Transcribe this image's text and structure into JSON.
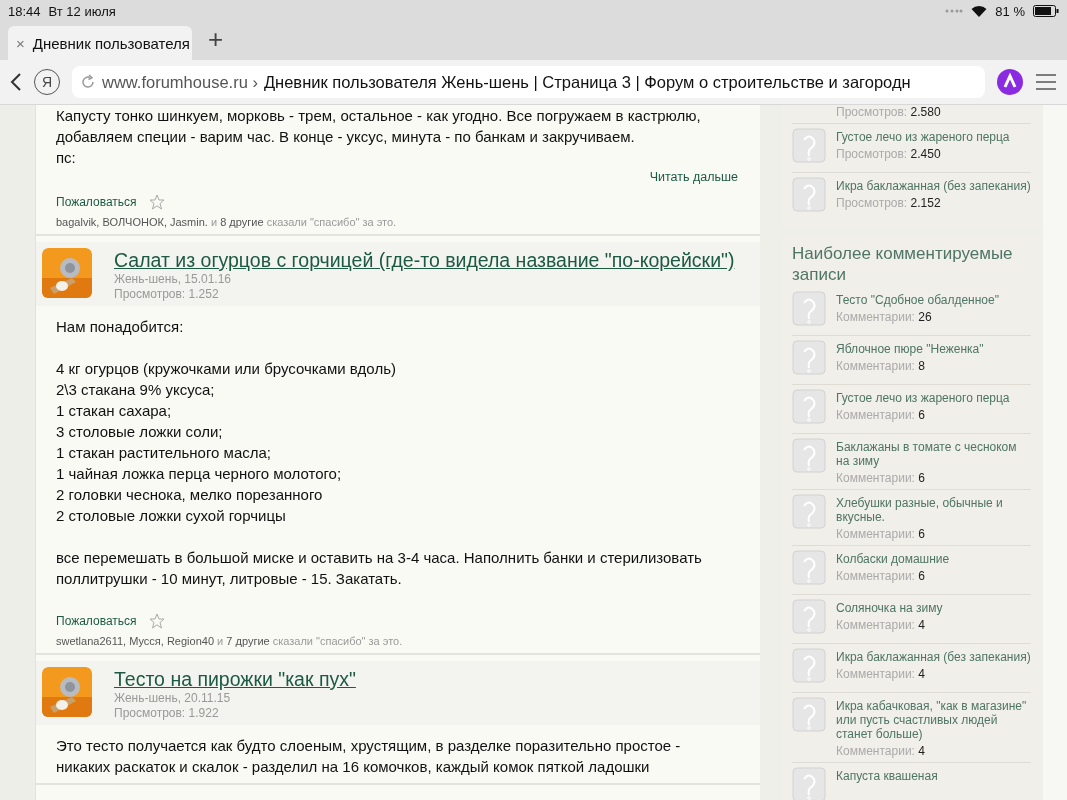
{
  "status_bar": {
    "time": "18:44",
    "date": "Вт 12 июля",
    "battery": "81 %"
  },
  "tabs": [
    {
      "label": "Дневник пользователя",
      "selected": true,
      "close": "×"
    }
  ],
  "new_tab": "+",
  "toolbar": {
    "yandex_button": "Я",
    "url_domain": "www.forumhouse.ru",
    "url_separator": "›",
    "url_title": "Дневник пользователя Жень-шень | Страница 3 | Форум о строительстве и загородн"
  },
  "posts": [
    {
      "paragraphs": [
        [
          "Капусту тонко шинкуем, морковь - трем, остальное - как угодно. Все погружаем в кастрюлю,",
          "добавляем специи - варим час. В конце - уксус, минута - по банкам и закручиваем.",
          "пс:"
        ]
      ],
      "read_more": "Читать дальше",
      "report": "Пожаловаться",
      "thanks": {
        "users": "bagalvik, ВОЛЧОНОК, Jasmin.",
        "and": "и",
        "others": "8 другие",
        "tail": "сказали \"спасибо\" за это."
      }
    },
    {
      "title": "Салат из огурцов с горчицей (где-то видела название \"по-корейски\")",
      "author_date": "Жень-шень, 15.01.16",
      "views": "Просмотров: 1.252",
      "paragraphs": [
        [
          "Нам понадобится:"
        ],
        [
          "4 кг огурцов (кружочками или брусочками вдоль)",
          "2\\3 стакана 9% уксуса;",
          "1 стакан сахара;",
          "3 столовые ложки соли;",
          "1 стакан растительного масла;",
          "1 чайная ложка перца черного молотого;",
          "2 головки чеснока, мелко порезанного",
          "2 столовые ложки сухой горчицы"
        ],
        [
          "все перемешать в большой миске и оставить на 3-4 часа. Наполнить банки и стерилизовать",
          "поллитрушки - 10 минут, литровые - 15. Закатать."
        ]
      ],
      "report": "Пожаловаться",
      "thanks": {
        "users": "swetlana2611, Мусся, Region40",
        "and": "и",
        "others": "7 другие",
        "tail": "сказали \"спасибо\" за это."
      }
    },
    {
      "title": "Тесто на пирожки \"как пух\"",
      "author_date": "Жень-шень, 20.11.15",
      "views": "Просмотров: 1.922",
      "paragraphs": [
        [
          "Это тесто получается как будто слоеным, хрустящим, в разделке поразительно простое -",
          "никаких раскаток и скалок - разделил на 16 комочков, каждый комок пяткой ладошки"
        ]
      ]
    }
  ],
  "sidebar": [
    {
      "items": [
        {
          "label": "Просмотров:",
          "value": "2.580"
        },
        {
          "title": "Густое лечо из жареного перца",
          "label": "Просмотров:",
          "value": "2.450"
        },
        {
          "title": "Икра баклажанная (без запекания)",
          "label": "Просмотров:",
          "value": "2.152"
        }
      ]
    },
    {
      "title": "Наиболее комментируемые записи",
      "items": [
        {
          "title": "Тесто \"Сдобное обалденное\"",
          "label": "Комментарии:",
          "value": "26"
        },
        {
          "title": "Яблочное пюре \"Неженка\"",
          "label": "Комментарии:",
          "value": "8"
        },
        {
          "title": "Густое лечо из жареного перца",
          "label": "Комментарии:",
          "value": "6"
        },
        {
          "title": "Баклажаны в томате с чесноком на зиму",
          "label": "Комментарии:",
          "value": "6"
        },
        {
          "title": "Хлебушки разные, обычные и вкусные.",
          "label": "Комментарии:",
          "value": "6"
        },
        {
          "title": "Колбаски домашние",
          "label": "Комментарии:",
          "value": "6"
        },
        {
          "title": "Соляночка на зиму",
          "label": "Комментарии:",
          "value": "4"
        },
        {
          "title": "Икра баклажанная (без запекания)",
          "label": "Комментарии:",
          "value": "4"
        },
        {
          "title": "Икра кабачковая, \"как в магазине\" или пусть счастливых людей станет больше)",
          "label": "Комментарии:",
          "value": "4"
        },
        {
          "title": "Капуста квашеная"
        }
      ]
    }
  ]
}
